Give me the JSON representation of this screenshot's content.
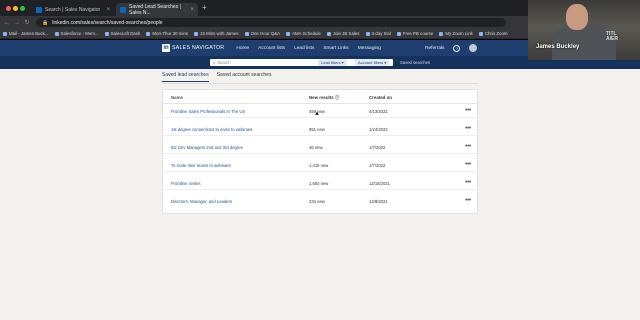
{
  "browser": {
    "tabs": [
      {
        "title": "Search | Sales Navigator"
      },
      {
        "title": "Saved Lead Searches | Sales N..."
      }
    ],
    "new_tab": "+",
    "url": "linkedin.com/sales/search/saved-searches/people",
    "bookmarks": [
      "Mail - James Buck...",
      "Salesforce - Mem...",
      "SalesLoft Dash",
      "Mon-Thur 30 mins",
      "15 Mins with James",
      "One Hour Q&A",
      "AMA Schedule",
      "Join JB Sales",
      "3-day trial",
      "Free PB course",
      "My Zoom Link",
      "Chris Zoom"
    ],
    "traffic_colors": [
      "#ff5f57",
      "#febc2e",
      "#28c840"
    ]
  },
  "ln": {
    "brand": "SALES NAVIGATOR",
    "nav": [
      "Home",
      "Account lists",
      "Lead lists",
      "Smart Links",
      "Messaging"
    ],
    "referrals": "Referrals",
    "help": "?",
    "search_placeholder": "Search",
    "lead_filters": "Lead filters ▾",
    "account_filters": "Account filters ▾",
    "saved_searches": "Saved searches"
  },
  "page": {
    "tabs": [
      "Saved lead searches",
      "Saved account searches"
    ],
    "table": {
      "headers": {
        "name": "Name",
        "new_results": "New results ⓘ",
        "created": "Created on"
      },
      "rows": [
        {
          "name": "Frontline Sales Professionals In The US",
          "new": "459 new",
          "date": "4/13/2022"
        },
        {
          "name": "1st degree connections to invite to webinars",
          "new": "851 new",
          "date": "1/24/2022"
        },
        {
          "name": "Biz Dev Managers 2nd and 3rd degree",
          "new": "46 new",
          "date": "1/7/2022"
        },
        {
          "name": "To invite their teams to webinars",
          "new": "1,418 new",
          "date": "1/7/2022"
        },
        {
          "name": "Frontline Invites",
          "new": "1,600 new",
          "date": "12/16/2021"
        },
        {
          "name": "Directors, Manager, and Leaders",
          "new": "234 new",
          "date": "12/8/2021"
        }
      ],
      "more": "•••"
    }
  },
  "webcam": {
    "name": "James Buckley",
    "shirt": "TITL\nAIER"
  },
  "colors": {
    "ln_nav": "#1d3e6e",
    "ln_link": "#1d4f91",
    "page_bg": "#f3f2ef"
  }
}
